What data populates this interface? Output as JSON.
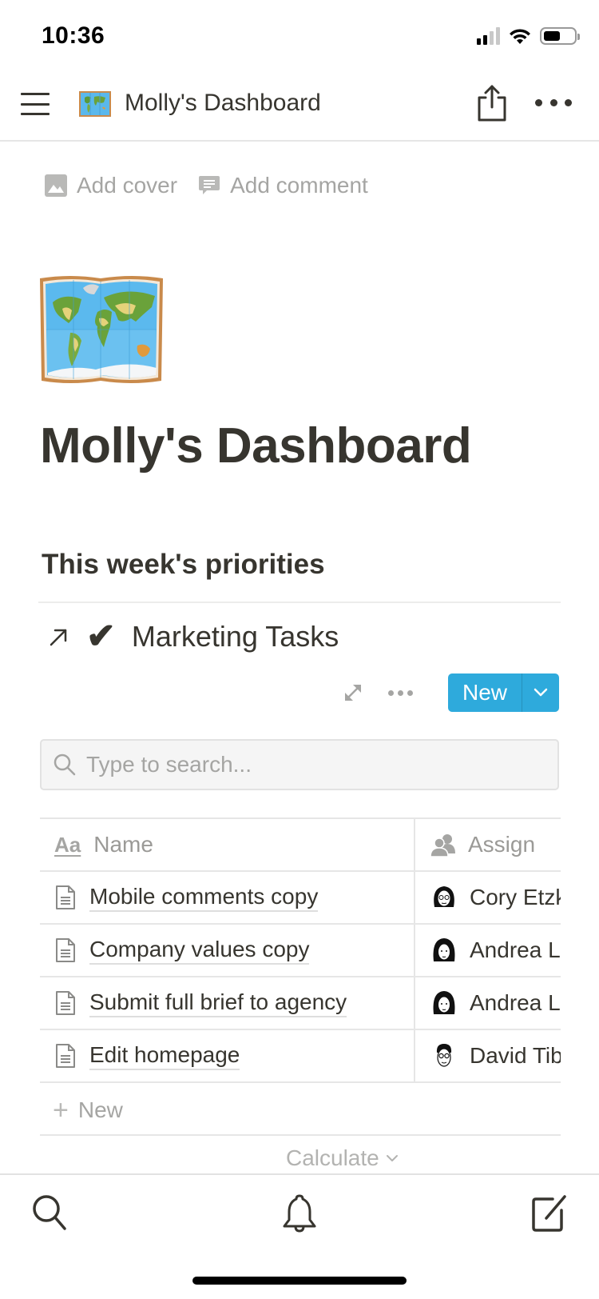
{
  "status_bar": {
    "time": "10:36",
    "signal_bars_active": 2,
    "signal_bars_total": 4,
    "battery_level": 0.55
  },
  "header": {
    "page_icon": "world-map-emoji",
    "title": "Molly's Dashboard",
    "share_icon": "share-icon",
    "more_icon": "more-horizontal-icon"
  },
  "page_controls": {
    "add_cover": "Add cover",
    "add_comment": "Add comment"
  },
  "page": {
    "icon": "world-map-emoji",
    "title": "Molly's Dashboard",
    "section_heading": "This week's priorities"
  },
  "database": {
    "link_icon": "arrow-up-right-icon",
    "icon": "✔",
    "title": "Marketing Tasks",
    "new_button": "New",
    "search_placeholder": "Type to search...",
    "search_value": "",
    "columns": [
      {
        "label": "Name",
        "icon": "Aa"
      },
      {
        "label": "Assign",
        "icon": "people-icon"
      }
    ],
    "rows": [
      {
        "name": "Mobile comments copy",
        "assignee": "Cory Etzkorn"
      },
      {
        "name": "Company values copy",
        "assignee": "Andrea Lim"
      },
      {
        "name": "Submit full brief to agency",
        "assignee": "Andrea Lim"
      },
      {
        "name": "Edit homepage",
        "assignee": "David Tibbitts"
      }
    ],
    "add_new_label": "New",
    "calculate_label": "Calculate"
  },
  "bottom_bar": {
    "search": "search-icon",
    "notifications": "bell-icon",
    "compose": "compose-icon"
  },
  "colors": {
    "accent": "#2eaadc",
    "text": "#37352f",
    "muted": "#a5a5a3"
  }
}
